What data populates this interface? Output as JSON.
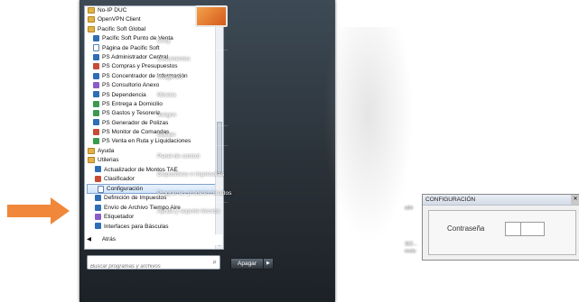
{
  "start_menu": {
    "programs": [
      {
        "label": "No-IP DUC",
        "icon": "folder"
      },
      {
        "label": "OpenVPN Client",
        "icon": "folder"
      },
      {
        "label": "Pacific Soft Global",
        "icon": "folder"
      },
      {
        "label": "Pacific Soft Punto de Venta",
        "icon": "app"
      },
      {
        "label": "Página de Pacific Soft",
        "icon": "doc"
      },
      {
        "label": "PS Administrador Central",
        "icon": "app"
      },
      {
        "label": "PS Compras y Presupuestos",
        "icon": "app2"
      },
      {
        "label": "PS Concentrador de Información",
        "icon": "app"
      },
      {
        "label": "PS Consultorio Anexo",
        "icon": "app4"
      },
      {
        "label": "PS Dependencia",
        "icon": "app"
      },
      {
        "label": "PS Entrega a Domicilio",
        "icon": "app3"
      },
      {
        "label": "PS Gastos y Tesoreria",
        "icon": "app3"
      },
      {
        "label": "PS Generador de Polizas",
        "icon": "app"
      },
      {
        "label": "PS Monitor de Comandas",
        "icon": "app2"
      },
      {
        "label": "PS Venta en Ruta y Liquidaciones",
        "icon": "app3"
      },
      {
        "label": "Ayuda",
        "icon": "folder"
      },
      {
        "label": "Utilerias",
        "icon": "folder"
      },
      {
        "label": "Actualizador de Montos TAE",
        "icon": "app"
      },
      {
        "label": "Clasificador",
        "icon": "app2"
      },
      {
        "label": "Configuración",
        "icon": "doc",
        "selected": true
      },
      {
        "label": "Definición de Impuestos",
        "icon": "app"
      },
      {
        "label": "Envío de Archivo Tiempo Aire",
        "icon": "app"
      },
      {
        "label": "Etiquetador",
        "icon": "app4"
      },
      {
        "label": "Interfaces para Básculas",
        "icon": "app"
      }
    ],
    "back_label": "Atrás",
    "search_placeholder": "Buscar programas y archivos",
    "right_items": [
      "Cecy",
      "Documentos",
      "Imágenes",
      "Música",
      "Juegos",
      "Equipo",
      "Panel de control",
      "Dispositivos e impresoras",
      "Programas predeterminados",
      "Ayuda y soporte técnico"
    ],
    "shutdown_label": "Apagar",
    "edge_text": [
      "ado",
      "112...",
      "recto"
    ]
  },
  "dialog": {
    "title": "CONFIGURACIÓN",
    "password_label": "Contraseña"
  },
  "colors": {
    "arrow": "#f0873a",
    "selection": "#cfe3fa"
  }
}
